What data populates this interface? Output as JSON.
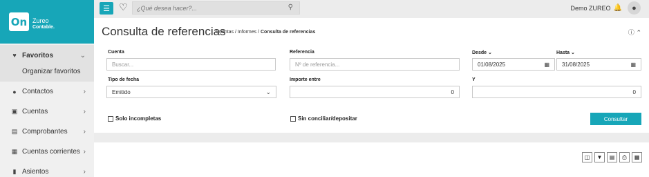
{
  "brand": {
    "logo_text": "On",
    "name": "Zureo",
    "subtitle": "Contable."
  },
  "topbar": {
    "search_placeholder": "¿Qué desea hacer?...",
    "user_name": "Demo ZUREO"
  },
  "sidebar": {
    "items": [
      {
        "label": "Favoritos",
        "icon": "heart-icon",
        "glyph": "♥",
        "chevron": "⌄"
      },
      {
        "label": "Contactos",
        "icon": "users-icon",
        "glyph": "👥",
        "chevron": "›"
      },
      {
        "label": "Cuentas",
        "icon": "gift-icon",
        "glyph": "🎁",
        "chevron": "›"
      },
      {
        "label": "Comprobantes",
        "icon": "file-icon",
        "glyph": "▤",
        "chevron": "›"
      },
      {
        "label": "Cuentas corrientes",
        "icon": "calculator-icon",
        "glyph": "▦",
        "chevron": "›"
      },
      {
        "label": "Asientos",
        "icon": "book-icon",
        "glyph": "▮",
        "chevron": "›"
      }
    ],
    "favorites_sub": "Organizar favoritos"
  },
  "page": {
    "title": "Consulta de referencias",
    "breadcrumb_prefix": "Cuentas / Informes / ",
    "breadcrumb_current": "Consulta de referencias"
  },
  "form": {
    "cuenta": {
      "label": "Cuenta",
      "placeholder": "Buscar..."
    },
    "referencia": {
      "label": "Referencia",
      "placeholder": "Nº de referencia..."
    },
    "desde": {
      "label": "Desde",
      "value": "01/08/2025"
    },
    "hasta": {
      "label": "Hasta",
      "value": "31/08/2025"
    },
    "tipo_fecha": {
      "label": "Tipo de fecha",
      "value": "Emitido"
    },
    "importe_entre": {
      "label": "Importe entre",
      "value": "0"
    },
    "y": {
      "label": "Y",
      "value": "0"
    },
    "solo_incompletas": "Solo incompletas",
    "sin_conciliar": "Sin conciliar/depositar",
    "consultar": "Consultar"
  },
  "colors": {
    "accent": "#17a6b8",
    "background": "#ececec"
  }
}
